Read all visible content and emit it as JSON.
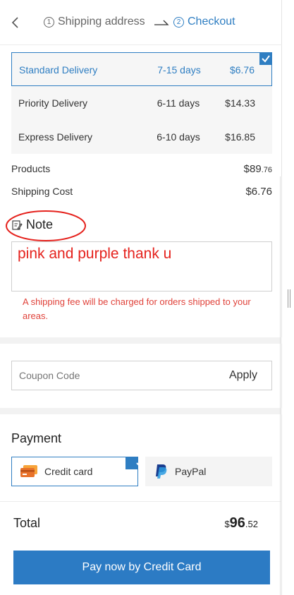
{
  "header": {
    "step1_num": "1",
    "step1_label": "Shipping address",
    "step2_num": "2",
    "step2_label": "Checkout"
  },
  "delivery": [
    {
      "name": "Standard Delivery",
      "days": "7-15 days",
      "price": "$6.76",
      "selected": true
    },
    {
      "name": "Priority Delivery",
      "days": "6-11 days",
      "price": "$14.33",
      "selected": false
    },
    {
      "name": "Express Delivery",
      "days": "6-10 days",
      "price": "$16.85",
      "selected": false
    }
  ],
  "summary": {
    "products_label": "Products",
    "products_currency_int": "$89",
    "products_cents": ".76",
    "shipping_label": "Shipping Cost",
    "shipping_value": "$6.76"
  },
  "note": {
    "title": "Note",
    "handwritten_text": "pink and purple thank u",
    "warning": "A shipping fee will be charged for orders shipped to your areas."
  },
  "coupon": {
    "placeholder": "Coupon Code",
    "apply_label": "Apply"
  },
  "payment": {
    "title": "Payment",
    "card_label": "Credit card",
    "paypal_label": "PayPal"
  },
  "total": {
    "label": "Total",
    "currency": "$",
    "int": "96",
    "cents": ".52"
  },
  "pay_button": "Pay now by Credit Card",
  "colors": {
    "accent": "#2f7ec2",
    "button": "#2c7bc4",
    "warning": "#e0423a",
    "annotation": "#e5221d"
  }
}
